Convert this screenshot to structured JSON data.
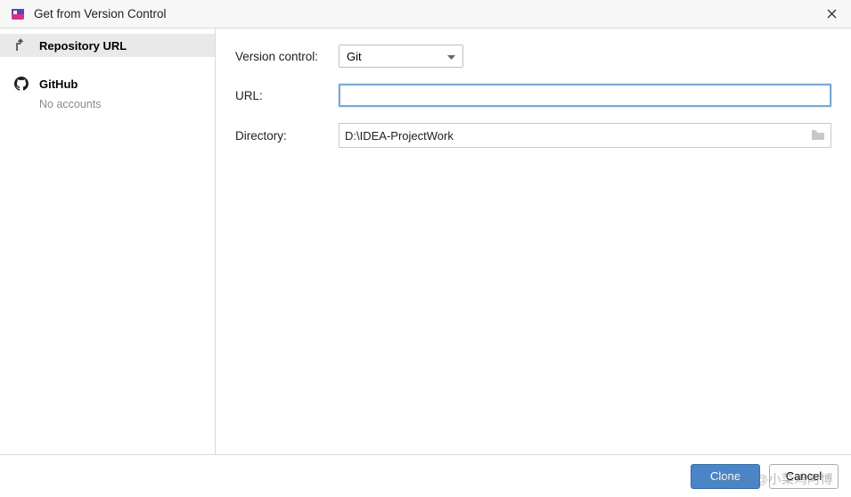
{
  "window": {
    "title": "Get from Version Control"
  },
  "sidebar": {
    "items": [
      {
        "label": "Repository URL"
      },
      {
        "label": "GitHub",
        "sub": "No accounts"
      }
    ]
  },
  "form": {
    "vc_label": "Version control:",
    "vc_value": "Git",
    "url_label": "URL:",
    "url_value": "",
    "dir_label": "Directory:",
    "dir_value": "D:\\IDEA-ProjectWork"
  },
  "footer": {
    "clone": "Clone",
    "cancel": "Cancel"
  },
  "watermark": "CSDN @小菜鸡阿博"
}
